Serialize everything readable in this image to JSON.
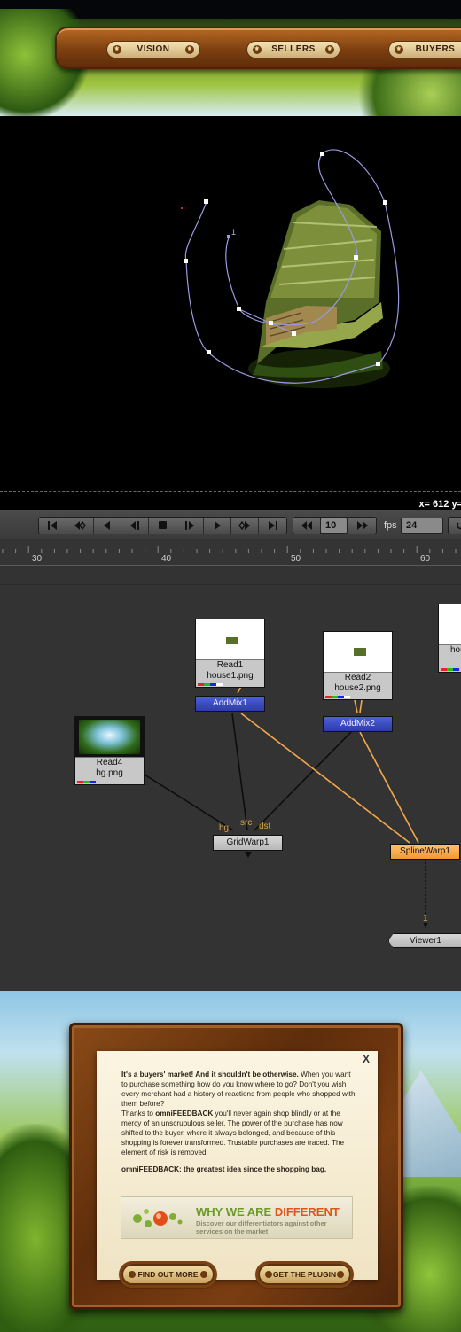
{
  "nav": {
    "items": [
      "VISION",
      "SELLERS",
      "BUYERS"
    ],
    "colors": {
      "bar": "#7d3f10",
      "button": "#e6cf98"
    }
  },
  "viewer": {
    "coordinate_readout": "x= 612 y=",
    "spline_point_label": "1",
    "spline_color": "#9a9ae0"
  },
  "toolbar": {
    "transport_buttons": [
      "first-frame-icon",
      "previous-keyframe-icon",
      "play-backward-icon",
      "step-back-icon",
      "stop-icon",
      "step-forward-icon",
      "play-forward-icon",
      "next-keyframe-icon",
      "last-frame-icon"
    ],
    "increment_value": "10",
    "fps_label": "fps",
    "fps_value": "24"
  },
  "timeline": {
    "ticks": [
      "30",
      "40",
      "50",
      "60"
    ]
  },
  "node_graph": {
    "read1": {
      "name": "Read1",
      "file": "house1.png"
    },
    "read2": {
      "name": "Read2",
      "file": "house2.png"
    },
    "read3": {
      "name": "",
      "file": "hou"
    },
    "read4": {
      "name": "Read4",
      "file": "bg.png"
    },
    "addmix1": "AddMix1",
    "addmix2": "AddMix2",
    "gridwarp": "GridWarp1",
    "splinewarp": "SplineWarp1",
    "viewer": "Viewer1",
    "pins": {
      "bg": "bg",
      "src": "src",
      "dst": "dst",
      "viewer_input": "1"
    },
    "colors": {
      "wire_orange": "#f5a84a",
      "wire_black": "#0d0d0d",
      "blue_node": "#3445c0",
      "orange_node": "#f8b35c"
    }
  },
  "promo": {
    "close": "X",
    "lead_bold": "It's a buyers' market! And it shouldn't be otherwise.",
    "lead_rest": " When you want to purchase something how do you know where to go? Don't you wish every merchant had a history of reactions from people who shopped with them before?",
    "p2_start": "Thanks to ",
    "p2_brand": "omniFEEDBACK",
    "p2_rest": " you'll never again shop blindly or at the mercy of an unscrupulous seller. The power of the purchase has now shifted to the buyer, where it always belonged, and because of this shopping is forever transformed. Trustable purchases are traced. The element of risk is removed.",
    "tagline": "omniFEEDBACK: the greatest idea since the shopping bag.",
    "why_prefix": "WHY WE ARE ",
    "why_accent": "DIFFERENT",
    "why_sub": "Discover our differentiators against other services on the market",
    "btn_find": "FIND OUT MORE",
    "btn_plugin": "GET THE PLUGIN"
  }
}
